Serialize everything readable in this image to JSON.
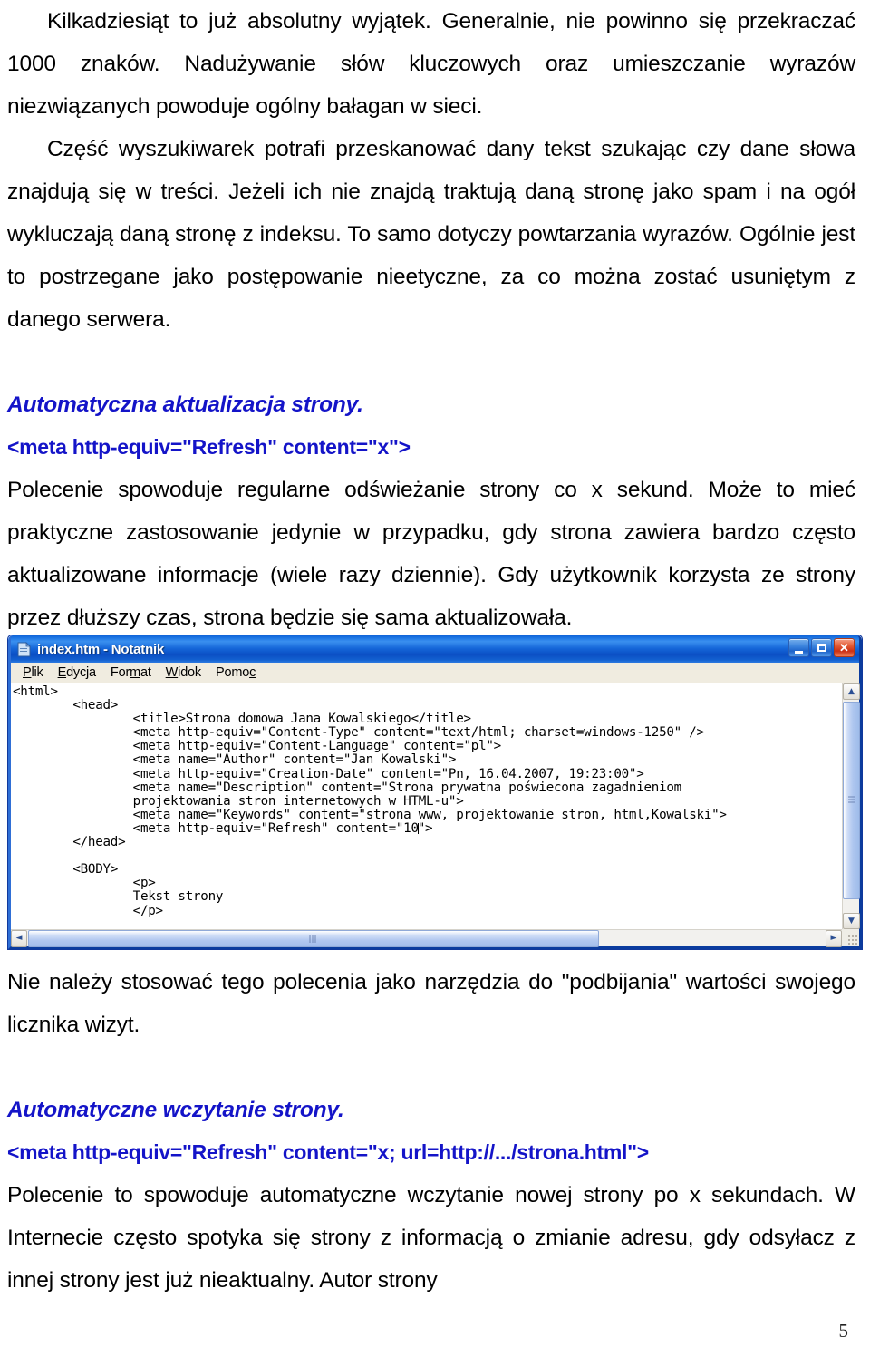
{
  "document": {
    "paragraphs": [
      {
        "id": "p1",
        "indent": true,
        "text": "Kilkadziesiąt to już absolutny wyjątek. Generalnie, nie powinno się przekraczać 1000 znaków. Nadużywanie słów kluczowych oraz umieszczanie wyrazów niezwiązanych powoduje ogólny bałagan w sieci."
      },
      {
        "id": "p2",
        "indent": true,
        "text": "Część wyszukiwarek potrafi przeskanować dany tekst szukając czy dane słowa znajdują się w treści. Jeżeli ich nie znajdą traktują daną stronę jako spam i na ogół wykluczają daną stronę z indeksu. To samo dotyczy powtarzania wyrazów. Ogólnie jest to postrzegane jako postępowanie nieetyczne, za co można zostać usuniętym z danego serwera."
      }
    ],
    "heading1": "Automatyczna aktualizacja strony.",
    "code1": "<meta http-equiv=\"Refresh\" content=\"x\">",
    "paragraph3": "Polecenie spowoduje regularne odświeżanie strony co x sekund. Może to mieć praktyczne zastosowanie jedynie w przypadku, gdy strona zawiera bardzo często aktualizowane informacje (wiele razy dziennie). Gdy użytkownik korzysta ze strony przez dłuższy czas, strona będzie się sama aktualizowała.",
    "paragraph4": "Nie należy stosować tego polecenia jako narzędzia do \"podbijania\" wartości swojego licznika wizyt.",
    "heading2": "Automatyczne wczytanie strony.",
    "code2": "<meta http-equiv=\"Refresh\" content=\"x; url=http://.../strona.html\">",
    "paragraph5": "Polecenie to spowoduje automatyczne wczytanie nowej strony po x sekundach. W Internecie często spotyka się strony z informacją o zmianie adresu, gdy odsyłacz z innej strony jest już nieaktualny. Autor strony",
    "page_number": "5",
    "heading_color": "#1414c8",
    "text_color": "#000000"
  },
  "notepad": {
    "title": "index.htm - Notatnik",
    "icon": "notepad-document-icon",
    "menu": [
      {
        "id": "plik",
        "prefix": "",
        "accel": "P",
        "suffix": "lik"
      },
      {
        "id": "edycja",
        "prefix": "",
        "accel": "E",
        "suffix": "dycja"
      },
      {
        "id": "format",
        "prefix": "For",
        "accel": "m",
        "suffix": "at"
      },
      {
        "id": "widok",
        "prefix": "",
        "accel": "W",
        "suffix": "idok"
      },
      {
        "id": "pomoc",
        "prefix": "Pomo",
        "accel": "c",
        "suffix": ""
      }
    ],
    "window_buttons": {
      "minimize": "minimize-button",
      "maximize": "maximize-button",
      "close": "close-button",
      "close_glyph": "✕"
    },
    "code": "<html>\n        <head>\n                <title>Strona domowa Jana Kowalskiego</title>\n                <meta http-equiv=\"Content-Type\" content=\"text/html; charset=windows-1250\" />\n                <meta http-equiv=\"Content-Language\" content=\"pl\">\n                <meta name=\"Author\" content=\"Jan Kowalski\">\n                <meta http-equiv=\"Creation-Date\" content=\"Pn, 16.04.2007, 19:23:00\">\n                <meta name=\"Description\" content=\"Strona prywatna poświecona zagadnieniom\n                projektowania stron internetowych w HTML-u\">\n                <meta name=\"Keywords\" content=\"strona www, projektowanie stron, html,Kowalski\">\n                <meta http-equiv=\"Refresh\" content=\"10",
    "code_after_caret": "\">\n        </head>\n\n        <BODY>\n                <p>\n                Tekst strony\n                </p>",
    "scrollbars": {
      "up_arrow": "▲",
      "down_arrow": "▼",
      "left_arrow": "◄",
      "right_arrow": "►"
    }
  }
}
